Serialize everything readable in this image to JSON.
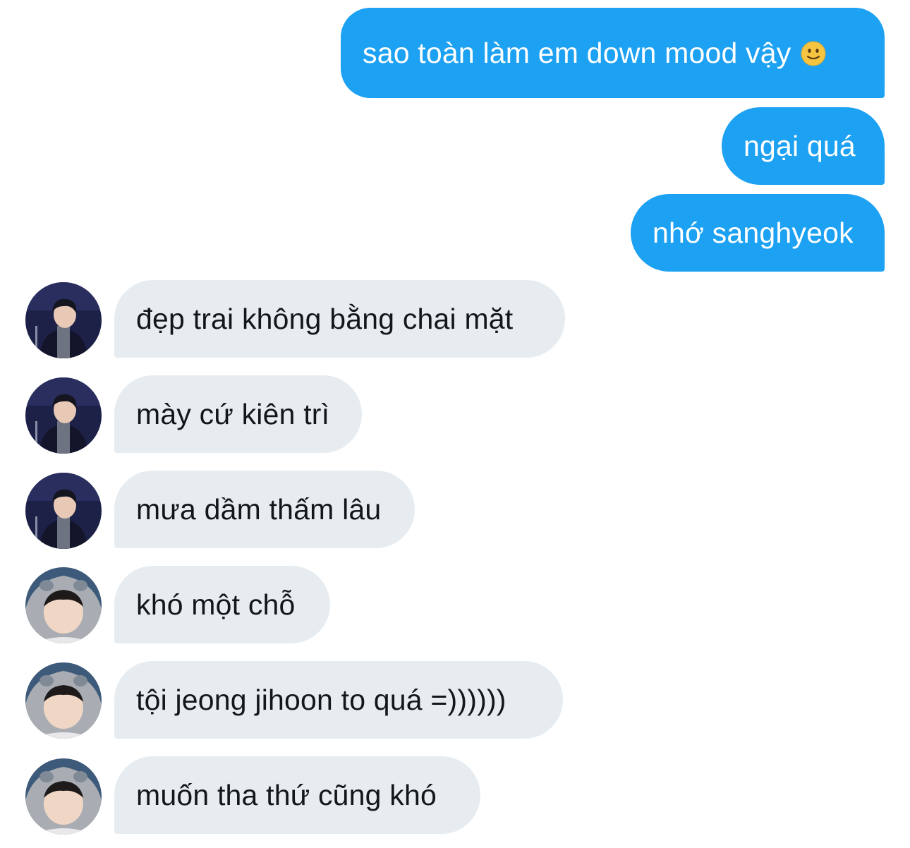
{
  "conversation": {
    "outgoing": [
      {
        "text": "sao toàn làm em down mood vậy",
        "emoji": "slightly-smiling-face-icon"
      },
      {
        "text": "ngại quá"
      },
      {
        "text": "nhớ sanghyeok"
      }
    ],
    "incoming": [
      {
        "sender": "avatar-a",
        "text": "đẹp trai không bằng chai mặt"
      },
      {
        "sender": "avatar-a",
        "text": "mày cứ kiên trì"
      },
      {
        "sender": "avatar-a",
        "text": "mưa dầm thấm lâu"
      },
      {
        "sender": "avatar-b",
        "text": "khó một chỗ"
      },
      {
        "sender": "avatar-b",
        "text": "tội jeong jihoon to quá =))))))"
      },
      {
        "sender": "avatar-b",
        "text": "muốn tha thứ cũng khó"
      }
    ]
  },
  "colors": {
    "outgoing_bubble": "#1da1f2",
    "incoming_bubble": "#e6ecf0",
    "outgoing_text": "#ffffff",
    "incoming_text": "#14171a"
  }
}
